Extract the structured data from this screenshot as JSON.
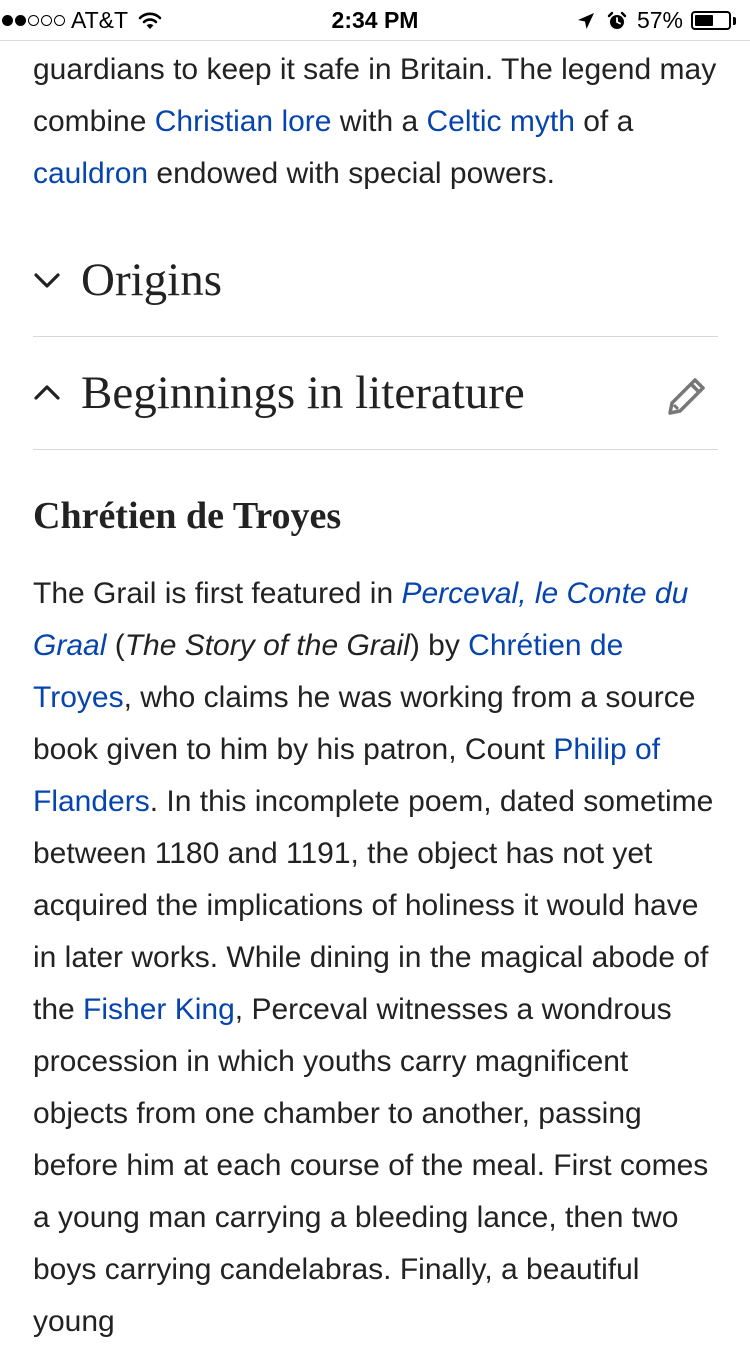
{
  "status_bar": {
    "carrier": "AT&T",
    "signal_bars_filled": 2,
    "signal_bars_total": 5,
    "time": "2:34 PM",
    "battery_percent": "57%",
    "battery_level": 0.57
  },
  "article": {
    "intro": [
      {
        "text": "guardians to keep it safe in Britain. The legend may combine "
      },
      {
        "text": "Christian lore",
        "link": true
      },
      {
        "text": " with a "
      },
      {
        "text": "Celtic myth",
        "link": true
      },
      {
        "text": " of a "
      },
      {
        "text": "cauldron",
        "link": true
      },
      {
        "text": " endowed with special powers."
      }
    ],
    "sections": [
      {
        "title": "Origins",
        "expanded": false
      },
      {
        "title": "Beginnings in literature",
        "expanded": true
      }
    ],
    "subheading": "Chrétien de Troyes",
    "body": [
      {
        "text": "The Grail is first featured in "
      },
      {
        "text": "Perceval, le Conte du Graal",
        "link": true,
        "italic": true
      },
      {
        "text": " ("
      },
      {
        "text": "The Story of the Grail",
        "italic": true
      },
      {
        "text": ") by "
      },
      {
        "text": "Chrétien de Troyes",
        "link": true
      },
      {
        "text": ", who claims he was working from a source book given to him by his patron, Count "
      },
      {
        "text": "Philip of Flanders",
        "link": true
      },
      {
        "text": ". In this incomplete poem, dated sometime between 1180 and 1191, the object has not yet acquired the implications of holiness it would have in later works. While dining in the magical abode of the "
      },
      {
        "text": "Fisher King",
        "link": true
      },
      {
        "text": ", Perceval witnesses a wondrous procession in which youths carry magnificent objects from one chamber to another, passing before him at each course of the meal. First comes a young man carrying a bleeding lance, then two boys carrying candelabras. Finally, a beautiful young"
      }
    ]
  },
  "colors": {
    "link": "#0645ad",
    "text": "#222222",
    "divider": "#d8d8d8",
    "icon": "#777777"
  },
  "icons": {
    "collapsed": "chevron-down-icon",
    "expanded": "chevron-up-icon",
    "edit": "pencil-icon",
    "wifi": "wifi-icon",
    "location": "location-arrow-icon",
    "alarm": "alarm-clock-icon"
  }
}
